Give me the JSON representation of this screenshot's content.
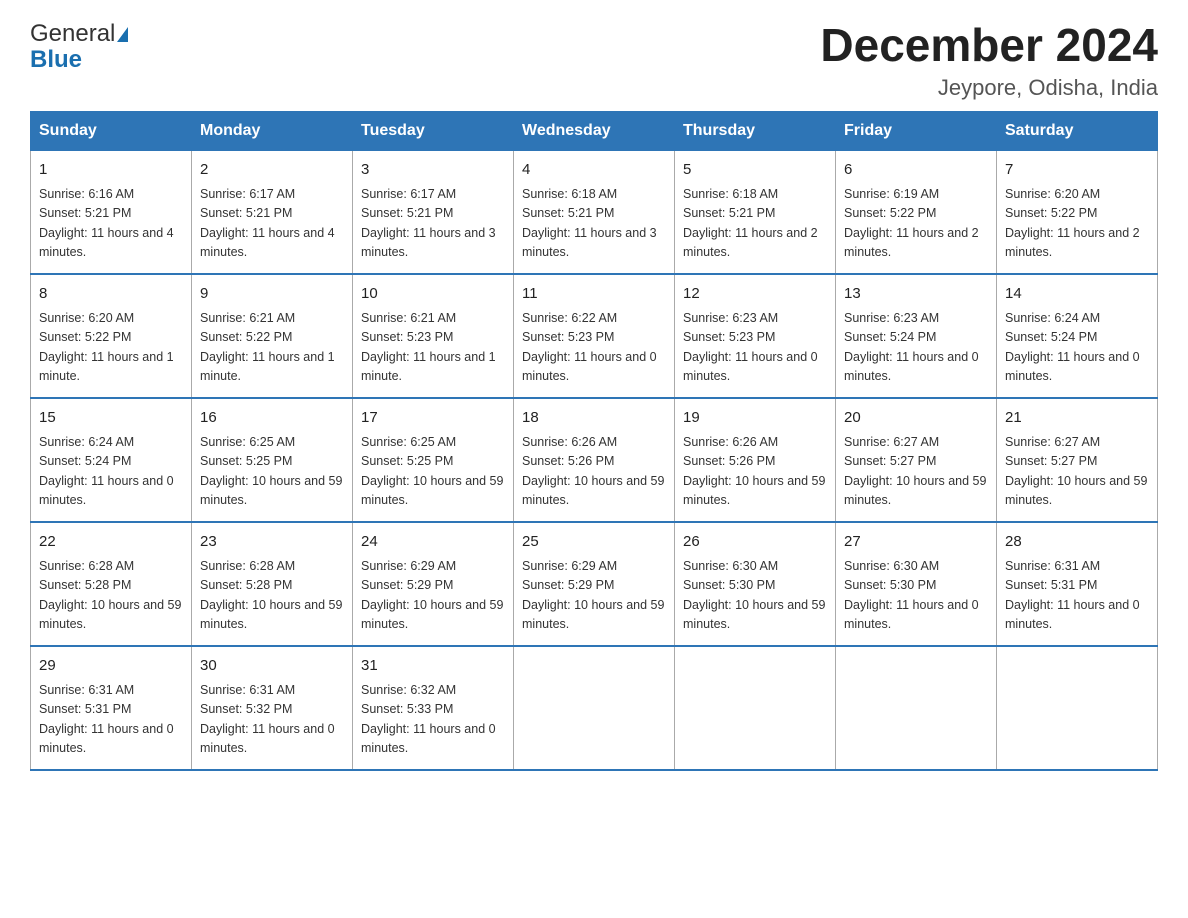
{
  "header": {
    "logo_general": "General",
    "logo_blue": "Blue",
    "month_title": "December 2024",
    "location": "Jeypore, Odisha, India"
  },
  "days_of_week": [
    "Sunday",
    "Monday",
    "Tuesday",
    "Wednesday",
    "Thursday",
    "Friday",
    "Saturday"
  ],
  "weeks": [
    [
      {
        "day": "1",
        "sunrise": "6:16 AM",
        "sunset": "5:21 PM",
        "daylight": "11 hours and 4 minutes."
      },
      {
        "day": "2",
        "sunrise": "6:17 AM",
        "sunset": "5:21 PM",
        "daylight": "11 hours and 4 minutes."
      },
      {
        "day": "3",
        "sunrise": "6:17 AM",
        "sunset": "5:21 PM",
        "daylight": "11 hours and 3 minutes."
      },
      {
        "day": "4",
        "sunrise": "6:18 AM",
        "sunset": "5:21 PM",
        "daylight": "11 hours and 3 minutes."
      },
      {
        "day": "5",
        "sunrise": "6:18 AM",
        "sunset": "5:21 PM",
        "daylight": "11 hours and 2 minutes."
      },
      {
        "day": "6",
        "sunrise": "6:19 AM",
        "sunset": "5:22 PM",
        "daylight": "11 hours and 2 minutes."
      },
      {
        "day": "7",
        "sunrise": "6:20 AM",
        "sunset": "5:22 PM",
        "daylight": "11 hours and 2 minutes."
      }
    ],
    [
      {
        "day": "8",
        "sunrise": "6:20 AM",
        "sunset": "5:22 PM",
        "daylight": "11 hours and 1 minute."
      },
      {
        "day": "9",
        "sunrise": "6:21 AM",
        "sunset": "5:22 PM",
        "daylight": "11 hours and 1 minute."
      },
      {
        "day": "10",
        "sunrise": "6:21 AM",
        "sunset": "5:23 PM",
        "daylight": "11 hours and 1 minute."
      },
      {
        "day": "11",
        "sunrise": "6:22 AM",
        "sunset": "5:23 PM",
        "daylight": "11 hours and 0 minutes."
      },
      {
        "day": "12",
        "sunrise": "6:23 AM",
        "sunset": "5:23 PM",
        "daylight": "11 hours and 0 minutes."
      },
      {
        "day": "13",
        "sunrise": "6:23 AM",
        "sunset": "5:24 PM",
        "daylight": "11 hours and 0 minutes."
      },
      {
        "day": "14",
        "sunrise": "6:24 AM",
        "sunset": "5:24 PM",
        "daylight": "11 hours and 0 minutes."
      }
    ],
    [
      {
        "day": "15",
        "sunrise": "6:24 AM",
        "sunset": "5:24 PM",
        "daylight": "11 hours and 0 minutes."
      },
      {
        "day": "16",
        "sunrise": "6:25 AM",
        "sunset": "5:25 PM",
        "daylight": "10 hours and 59 minutes."
      },
      {
        "day": "17",
        "sunrise": "6:25 AM",
        "sunset": "5:25 PM",
        "daylight": "10 hours and 59 minutes."
      },
      {
        "day": "18",
        "sunrise": "6:26 AM",
        "sunset": "5:26 PM",
        "daylight": "10 hours and 59 minutes."
      },
      {
        "day": "19",
        "sunrise": "6:26 AM",
        "sunset": "5:26 PM",
        "daylight": "10 hours and 59 minutes."
      },
      {
        "day": "20",
        "sunrise": "6:27 AM",
        "sunset": "5:27 PM",
        "daylight": "10 hours and 59 minutes."
      },
      {
        "day": "21",
        "sunrise": "6:27 AM",
        "sunset": "5:27 PM",
        "daylight": "10 hours and 59 minutes."
      }
    ],
    [
      {
        "day": "22",
        "sunrise": "6:28 AM",
        "sunset": "5:28 PM",
        "daylight": "10 hours and 59 minutes."
      },
      {
        "day": "23",
        "sunrise": "6:28 AM",
        "sunset": "5:28 PM",
        "daylight": "10 hours and 59 minutes."
      },
      {
        "day": "24",
        "sunrise": "6:29 AM",
        "sunset": "5:29 PM",
        "daylight": "10 hours and 59 minutes."
      },
      {
        "day": "25",
        "sunrise": "6:29 AM",
        "sunset": "5:29 PM",
        "daylight": "10 hours and 59 minutes."
      },
      {
        "day": "26",
        "sunrise": "6:30 AM",
        "sunset": "5:30 PM",
        "daylight": "10 hours and 59 minutes."
      },
      {
        "day": "27",
        "sunrise": "6:30 AM",
        "sunset": "5:30 PM",
        "daylight": "11 hours and 0 minutes."
      },
      {
        "day": "28",
        "sunrise": "6:31 AM",
        "sunset": "5:31 PM",
        "daylight": "11 hours and 0 minutes."
      }
    ],
    [
      {
        "day": "29",
        "sunrise": "6:31 AM",
        "sunset": "5:31 PM",
        "daylight": "11 hours and 0 minutes."
      },
      {
        "day": "30",
        "sunrise": "6:31 AM",
        "sunset": "5:32 PM",
        "daylight": "11 hours and 0 minutes."
      },
      {
        "day": "31",
        "sunrise": "6:32 AM",
        "sunset": "5:33 PM",
        "daylight": "11 hours and 0 minutes."
      },
      null,
      null,
      null,
      null
    ]
  ]
}
